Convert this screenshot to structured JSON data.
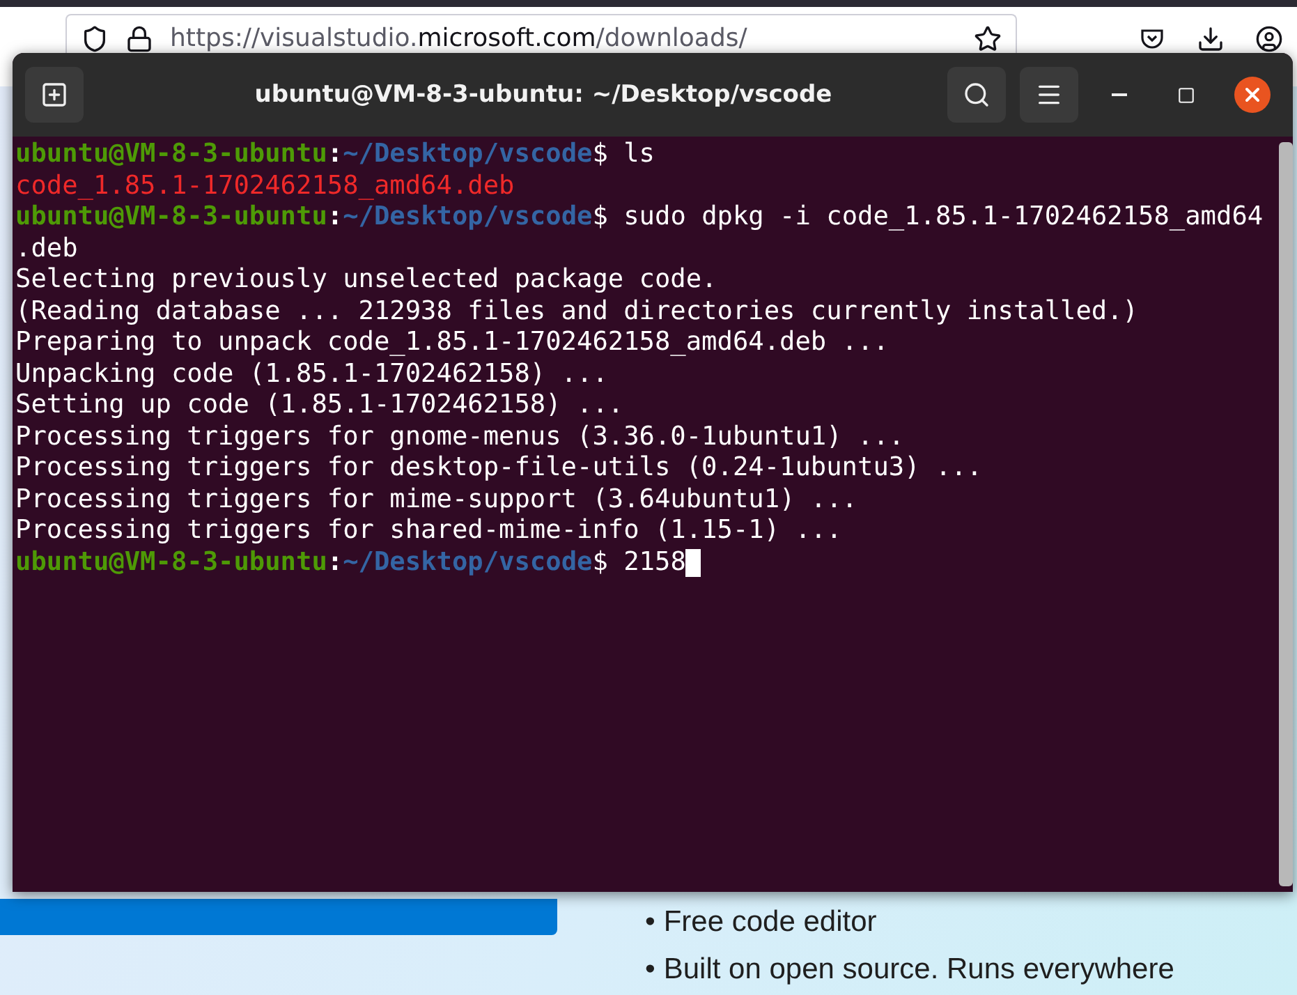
{
  "browser": {
    "url_host_prefix": "https://visualstudio.",
    "url_host": "microsoft.com",
    "url_path": "/downloads/"
  },
  "page": {
    "bullets": [
      {
        "marker": "•",
        "text": "Free code editor"
      },
      {
        "marker": "•",
        "text": "Built on open source. Runs everywhere"
      }
    ]
  },
  "terminal": {
    "title": "ubuntu@VM-8-3-ubuntu: ~/Desktop/vscode",
    "lines": [
      {
        "kind": "prompt",
        "user": "ubuntu@VM-8-3-ubuntu",
        "sep": ":",
        "path": "~/Desktop/vscode",
        "sign": "$",
        "command": " ls",
        "cursor": false
      },
      {
        "kind": "file",
        "text": "code_1.85.1-1702462158_amd64.deb"
      },
      {
        "kind": "prompt",
        "user": "ubuntu@VM-8-3-ubuntu",
        "sep": ":",
        "path": "~/Desktop/vscode",
        "sign": "$",
        "command": " sudo dpkg -i code_1.85.1-1702462158_amd64",
        "cursor": false
      },
      {
        "kind": "output",
        "text": ".deb"
      },
      {
        "kind": "output",
        "text": "Selecting previously unselected package code."
      },
      {
        "kind": "output",
        "text": "(Reading database ... 212938 files and directories currently installed.)"
      },
      {
        "kind": "output",
        "text": "Preparing to unpack code_1.85.1-1702462158_amd64.deb ..."
      },
      {
        "kind": "output",
        "text": "Unpacking code (1.85.1-1702462158) ..."
      },
      {
        "kind": "output",
        "text": "Setting up code (1.85.1-1702462158) ..."
      },
      {
        "kind": "output",
        "text": "Processing triggers for gnome-menus (3.36.0-1ubuntu1) ..."
      },
      {
        "kind": "output",
        "text": "Processing triggers for desktop-file-utils (0.24-1ubuntu3) ..."
      },
      {
        "kind": "output",
        "text": "Processing triggers for mime-support (3.64ubuntu1) ..."
      },
      {
        "kind": "output",
        "text": "Processing triggers for shared-mime-info (1.15-1) ..."
      },
      {
        "kind": "prompt",
        "user": "ubuntu@VM-8-3-ubuntu",
        "sep": ":",
        "path": "~/Desktop/vscode",
        "sign": "$",
        "command": " 2158",
        "cursor": true
      }
    ]
  }
}
